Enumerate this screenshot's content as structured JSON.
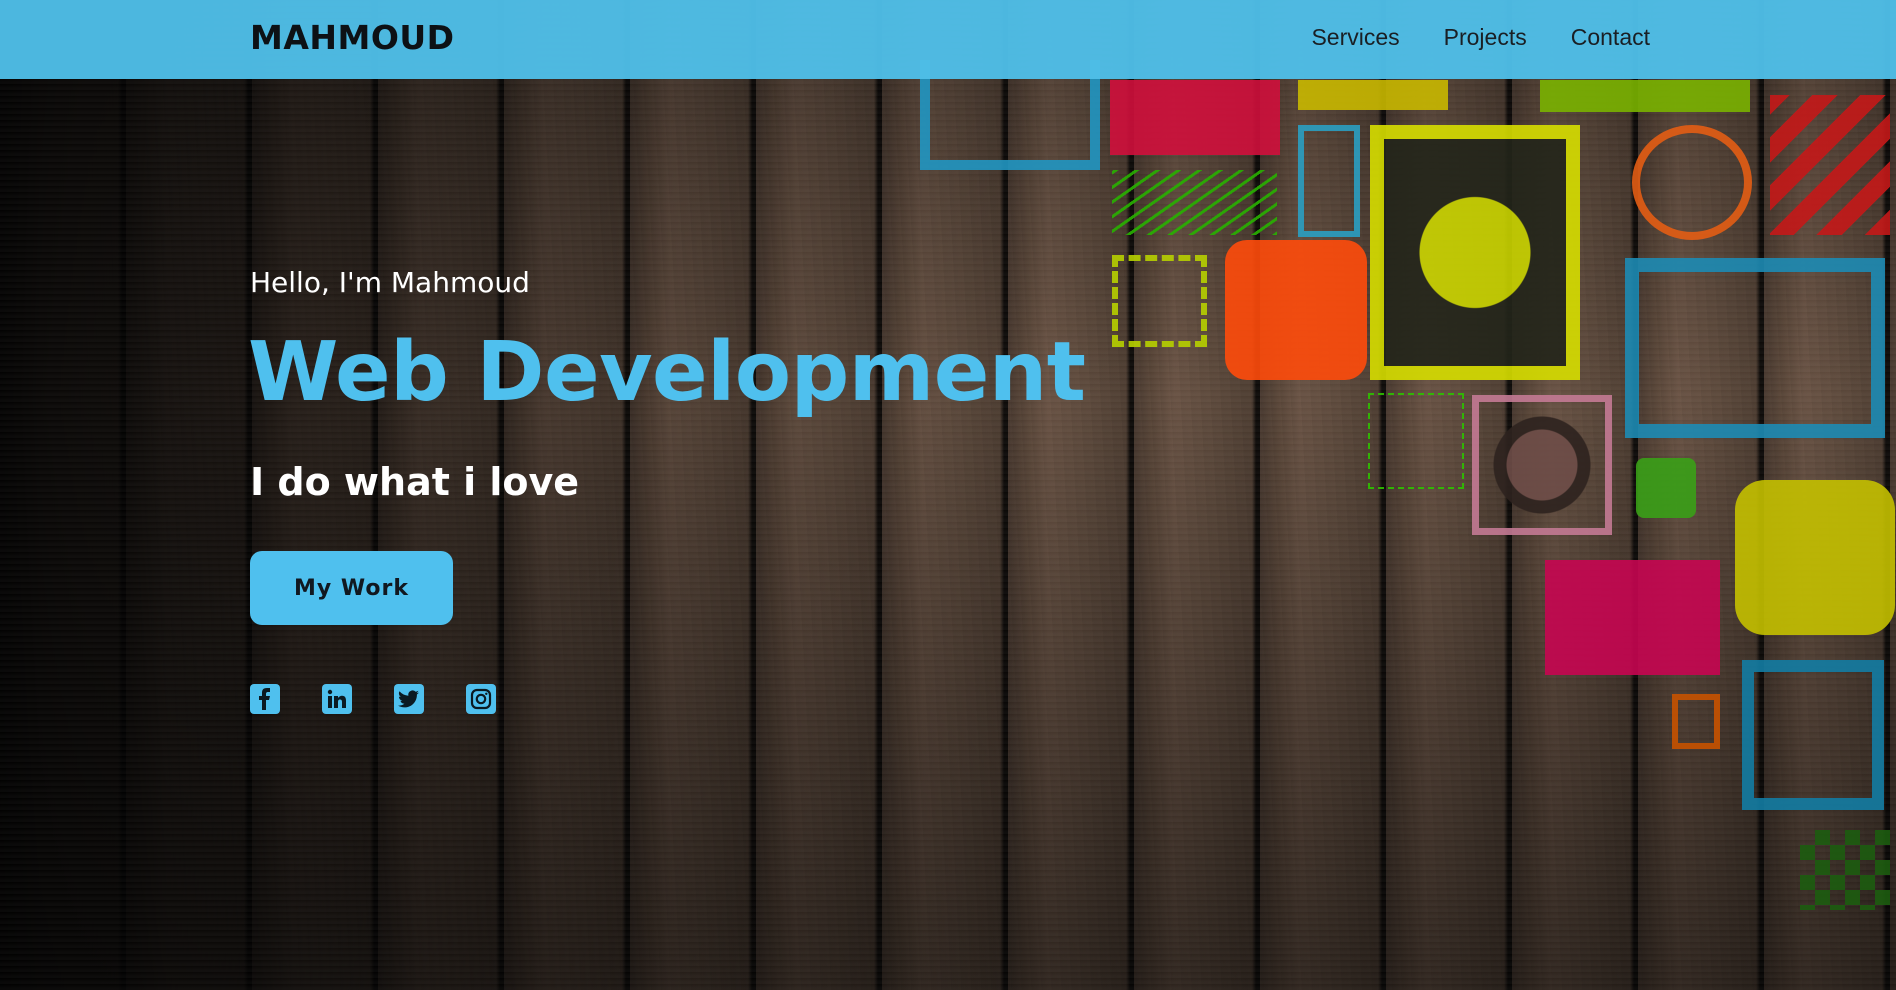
{
  "brand": "MAHMOUD",
  "nav": [
    "Services",
    "Projects",
    "Contact"
  ],
  "hero": {
    "greeting": "Hello, I'm Mahmoud",
    "title": "Web Development",
    "tagline": "I do what i love",
    "cta": "My Work"
  },
  "social": [
    "facebook-icon",
    "linkedin-icon",
    "twitter-icon",
    "instagram-icon"
  ],
  "colors": {
    "accent": "#4fc0ee",
    "header": "#4fbee8",
    "text": "#ffffff"
  }
}
